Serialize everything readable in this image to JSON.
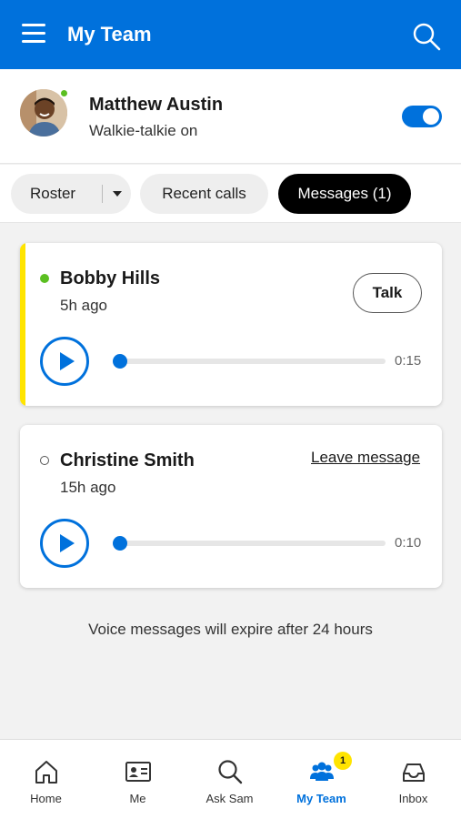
{
  "header": {
    "title": "My Team",
    "menu_icon": "hamburger-menu-icon",
    "search_icon": "search-icon",
    "color": "#0071dc"
  },
  "profile": {
    "name": "Matthew Austin",
    "status": "Walkie-talkie on",
    "presence": "online",
    "walkie_talkie_on": true
  },
  "tabs": [
    {
      "label": "Roster",
      "active": false
    },
    {
      "label": "Recent calls",
      "active": false
    },
    {
      "label": "Messages (1)",
      "active": true
    }
  ],
  "messages": [
    {
      "name": "Bobby Hills",
      "ago": "5h ago",
      "presence": "online",
      "action": "Talk",
      "duration": "0:15",
      "unread": true
    },
    {
      "name": "Christine Smith",
      "ago": "15h ago",
      "presence": "offline",
      "action": "Leave message",
      "duration": "0:10",
      "unread": false
    }
  ],
  "expire_note": "Voice messages will expire after 24 hours",
  "bottom_nav": [
    {
      "label": "Home",
      "icon": "home-icon"
    },
    {
      "label": "Me",
      "icon": "id-card-icon"
    },
    {
      "label": "Ask Sam",
      "icon": "search-icon"
    },
    {
      "label": "My Team",
      "icon": "team-icon",
      "active": true,
      "badge": "1"
    },
    {
      "label": "Inbox",
      "icon": "inbox-icon"
    }
  ],
  "colors": {
    "accent": "#0071dc",
    "highlight": "#ffe400",
    "online": "#5bbf21"
  }
}
